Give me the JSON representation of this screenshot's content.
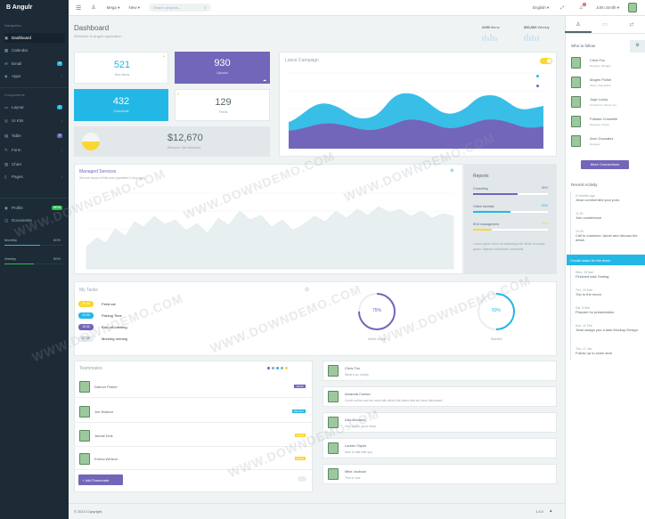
{
  "brand": "Angulr",
  "sidebar": {
    "nav_header": "Navigation",
    "items": [
      {
        "label": "Dashboard",
        "badge": "",
        "icon": "dashboard-icon"
      },
      {
        "label": "Calendar",
        "badge": "",
        "icon": "calendar-icon"
      },
      {
        "label": "Email",
        "badge": "9",
        "icon": "email-icon"
      },
      {
        "label": "Apps",
        "badge": "",
        "icon": "apps-icon"
      }
    ],
    "components_header": "Components",
    "components": [
      {
        "label": "Layout",
        "badge": "2"
      },
      {
        "label": "UI Kits",
        "badge": ""
      },
      {
        "label": "Table",
        "badge": "3"
      },
      {
        "label": "Form",
        "badge": ""
      },
      {
        "label": "Chart",
        "badge": ""
      },
      {
        "label": "Pages",
        "badge": ""
      }
    ],
    "your_stuff": [
      {
        "label": "Profile",
        "badge": "NEW"
      },
      {
        "label": "Documents",
        "badge": ""
      }
    ],
    "progress": [
      {
        "label": "Monthly",
        "value": "60%",
        "fraction": 0.6
      },
      {
        "label": "Weekly",
        "value": "50%",
        "fraction": 0.5
      }
    ]
  },
  "topbar": {
    "mega": "Mega",
    "new": "New",
    "search_placeholder": "Search projects...",
    "language": "English",
    "notif_count": "2",
    "user": "John.Smith"
  },
  "page": {
    "title": "Dashboard",
    "subtitle": "Welcome to angulr application",
    "stat1_value": "2290",
    "stat1_label": "items",
    "stat2_value": "$30,000",
    "stat2_label": "Weekly"
  },
  "stats": {
    "new_items": {
      "value": "521",
      "label": "New Items"
    },
    "uploads": {
      "value": "930",
      "label": "Uploads"
    },
    "comments": {
      "value": "432",
      "label": "Comments"
    },
    "feeds": {
      "value": "129",
      "label": "Feeds"
    },
    "revenue": {
      "value": "$12,670",
      "label": "Revenue, this Weekend"
    }
  },
  "campaign": {
    "title": "Latest Campaign"
  },
  "managed": {
    "title": "Managed Services",
    "subtitle": "Service report of this year (updated 1 hour ago)"
  },
  "reports": {
    "title": "Reports",
    "rows": [
      {
        "label": "Consulting",
        "value": "80%",
        "fraction": 0.8,
        "color": "#7266ba"
      },
      {
        "label": "Online tutorials",
        "value": "50%",
        "fraction": 0.5,
        "color": "#23b7e5"
      },
      {
        "label": "EDU management",
        "value": "25%",
        "fraction": 0.25,
        "color": "#fad733"
      }
    ],
    "note": "Lorem ipsum dolor sit adipiscing elit. Morbi id neque quam. Aliquam sollicitudin venenatis."
  },
  "tasks": {
    "title": "My Tasks",
    "items": [
      {
        "time": "11:30",
        "label": "Feed cat",
        "color": "#fad733"
      },
      {
        "time": "12:30",
        "label": "Fishing Time",
        "color": "#23b7e5"
      },
      {
        "time": "19:30",
        "label": "Kick-off meeting",
        "color": "#7266ba"
      },
      {
        "time": "07:30",
        "label": "Morning running",
        "color": "#e8eff0"
      }
    ],
    "work_done": {
      "value": "75%",
      "label": "Work Done",
      "fraction": 0.75
    },
    "started": {
      "value": "50%",
      "label": "Started",
      "fraction": 0.5
    }
  },
  "teammates": {
    "title": "Teammates",
    "rows": [
      {
        "name": "Damon Parker",
        "badge": "Admin",
        "color": "#7266ba"
      },
      {
        "name": "Joe Waston",
        "badge": "Member",
        "color": "#23b7e5"
      },
      {
        "name": "Jannie Dvis",
        "badge": "Guest",
        "color": "#fad733"
      },
      {
        "name": "Emma Welson",
        "badge": "Guest",
        "color": "#fad733"
      }
    ],
    "add_button": "Add Teammate"
  },
  "messages": [
    {
      "name": "Chris Fox",
      "text": "What's up, buddy"
    },
    {
      "name": "Amanda Conlan",
      "text": "Come online and we need talk about the plans that we have discussed"
    },
    {
      "name": "Dan Doorack",
      "text": "Hey, Some good news"
    },
    {
      "name": "Lauren Taylor",
      "text": "Nice to talk with you."
    },
    {
      "name": "Mike Jackson",
      "text": "This is nice"
    }
  ],
  "aside": {
    "who_title": "Who to follow",
    "people": [
      {
        "name": "Chris Fox",
        "role": "Designer, Blogger"
      },
      {
        "name": "Mogen Polish",
        "role": "Writer, Mag Editor"
      },
      {
        "name": "Joge Lucky",
        "role": "Art director, Movie Cut"
      },
      {
        "name": "Folisise Chosielie",
        "role": "Musician, Player"
      },
      {
        "name": "Aron Gonzalez",
        "role": "Designer"
      }
    ],
    "more_button": "More Connections",
    "activity_title": "Recent Activity",
    "activities": [
      {
        "time": "5 minutes ago",
        "text": "Jessi commented your post."
      },
      {
        "time": "11:30",
        "text": "Join comference"
      },
      {
        "time": "10:30",
        "text": "Call to customer Jacob and discuss the detail."
      },
      {
        "time": "",
        "text": "Create tasks for the team"
      },
      {
        "time": "Wed, 25 Mar",
        "text": "Finished task Testing."
      },
      {
        "time": "Thu, 10 Mar",
        "text": "Trip to the moon"
      },
      {
        "time": "Sat, 5 Mar",
        "text": "Prepare for presentation"
      },
      {
        "time": "Sun, 11 Feb",
        "text": "Jessi assign you a task Mockup Design."
      },
      {
        "time": "Thu, 17 Jan",
        "text": "Follow up to close deal"
      }
    ]
  },
  "footer": {
    "copyright": "© 2014 Copyright.",
    "version": "1.4.0"
  },
  "watermark": "WWW.DOWNDEMO.COM"
}
